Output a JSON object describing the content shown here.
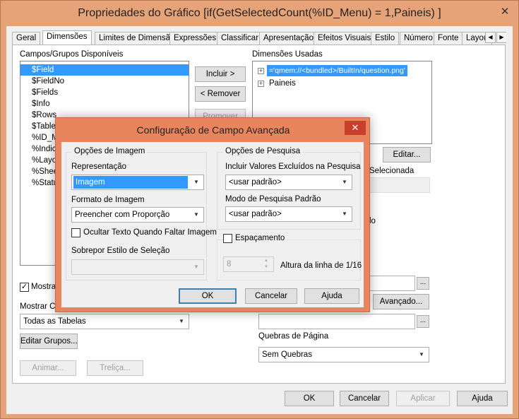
{
  "window": {
    "title": "Propriedades do Gráfico [if(GetSelectedCount(%ID_Menu) = 1,Paineis) ]",
    "close_glyph": "✕"
  },
  "tabs": [
    "Geral",
    "Dimensões",
    "Limites de Dimensão",
    "Expressões",
    "Classificar",
    "Apresentação",
    "Efeitos Visuais",
    "Estilo",
    "Número",
    "Fonte",
    "Layou"
  ],
  "tab_scroll": {
    "left": "◀",
    "right": "▶"
  },
  "left": {
    "fields_label": "Campos/Grupos Disponíveis",
    "fields": [
      "$Field",
      "$FieldNo",
      "$Fields",
      "$Info",
      "$Rows",
      "$Table",
      "%ID_M",
      "%Indice",
      "%Layou",
      "%Sheet",
      "%Statu"
    ],
    "show_label": "Mostrar",
    "show_checked_glyph": "✓",
    "show_fields_from_label": "Mostrar Ca",
    "table_select_value": "Todas as Tabelas",
    "edit_groups_label": "Editar Grupos...",
    "animate_label": "Animar...",
    "trellis_label": "Treliça..."
  },
  "middle": {
    "add_label": "Incluir >",
    "remove_label": "< Remover",
    "promote_label": "Promover"
  },
  "right": {
    "used_label": "Dimensões Usadas",
    "used": [
      "='qmem://<bundled>/BuiltIn/question.png'",
      "Paineis"
    ],
    "expand_glyph": "+",
    "edit_label": "Editar...",
    "selected_label": "Selecionada",
    "field_label_fragment": "lo",
    "advanced_label": "Avançado...",
    "ellipsis": "...",
    "page_breaks_label": "Quebras de Página",
    "page_breaks_value": "Sem Quebras"
  },
  "footer": {
    "ok": "OK",
    "cancel": "Cancelar",
    "apply": "Aplicar",
    "help": "Ajuda"
  },
  "dialog": {
    "title": "Configuração de Campo Avançada",
    "close_glyph": "✕",
    "image_options_title": "Opções de Imagem",
    "representation_label": "Representação",
    "representation_value": "Imagem",
    "image_format_label": "Formato de Imagem",
    "image_format_value": "Preencher com Proporção",
    "hide_text_label": "Ocultar Texto Quando Faltar Imagem",
    "override_label": "Sobrepor Estilo de Seleção",
    "override_value": "",
    "search_options_title": "Opções de Pesquisa",
    "include_excluded_label": "Incluir Valores Excluídos na Pesquisa",
    "include_excluded_value": "<usar padrão>",
    "default_search_label": "Modo de Pesquisa Padrão",
    "default_search_value": "<usar padrão>",
    "spacing_label": "Espaçamento",
    "line_height_value": "8",
    "line_height_label": "Altura da linha de 1/16",
    "ok": "OK",
    "cancel": "Cancelar",
    "help": "Ajuda"
  },
  "colors": {
    "title_bar": "#e6a377",
    "dialog_bar": "#e9855e",
    "selection": "#3399ff",
    "close_red": "#c7402b"
  }
}
